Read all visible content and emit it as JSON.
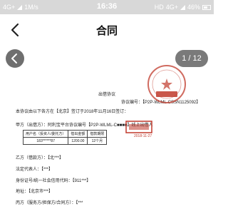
{
  "status_bar": {
    "network": "4G+",
    "speed": "1M/s",
    "time": "16:36",
    "hd": "HD",
    "network_right": "4G+",
    "battery": "46%"
  },
  "nav": {
    "title": "合同"
  },
  "viewer": {
    "page_indicator": "1 / 12"
  },
  "document": {
    "title": "出借协议",
    "agreement_no": "协议编号：【P2P-WLML-CSSN1125092】",
    "intro": "本协议由以下各方在【北京】签订于2018年11月16日签订：",
    "party_a": "甲方（出借方）：阿利宝平台协议编号【P2P-WLML-C■■■■】线上出借人",
    "lender_table": {
      "headers": [
        "用户名（投资人/委托方）",
        "借出金额",
        "借款期限"
      ],
      "row": [
        "183******87",
        "1200.00",
        "12个月"
      ]
    },
    "party_b": "乙方（借款方）：【北***】",
    "legal_rep": "法定代表人：【***】",
    "id_no": "身份证号/统一社会信用代码：【911***】",
    "address": "地址：【北京市***】",
    "party_c": "丙方（服务方/担保方/合同方）：【***"
  },
  "stamps": {
    "seal_text": "合同专用章",
    "stamp_date": "2018-11-27",
    "seal_color": "#c0392b"
  }
}
